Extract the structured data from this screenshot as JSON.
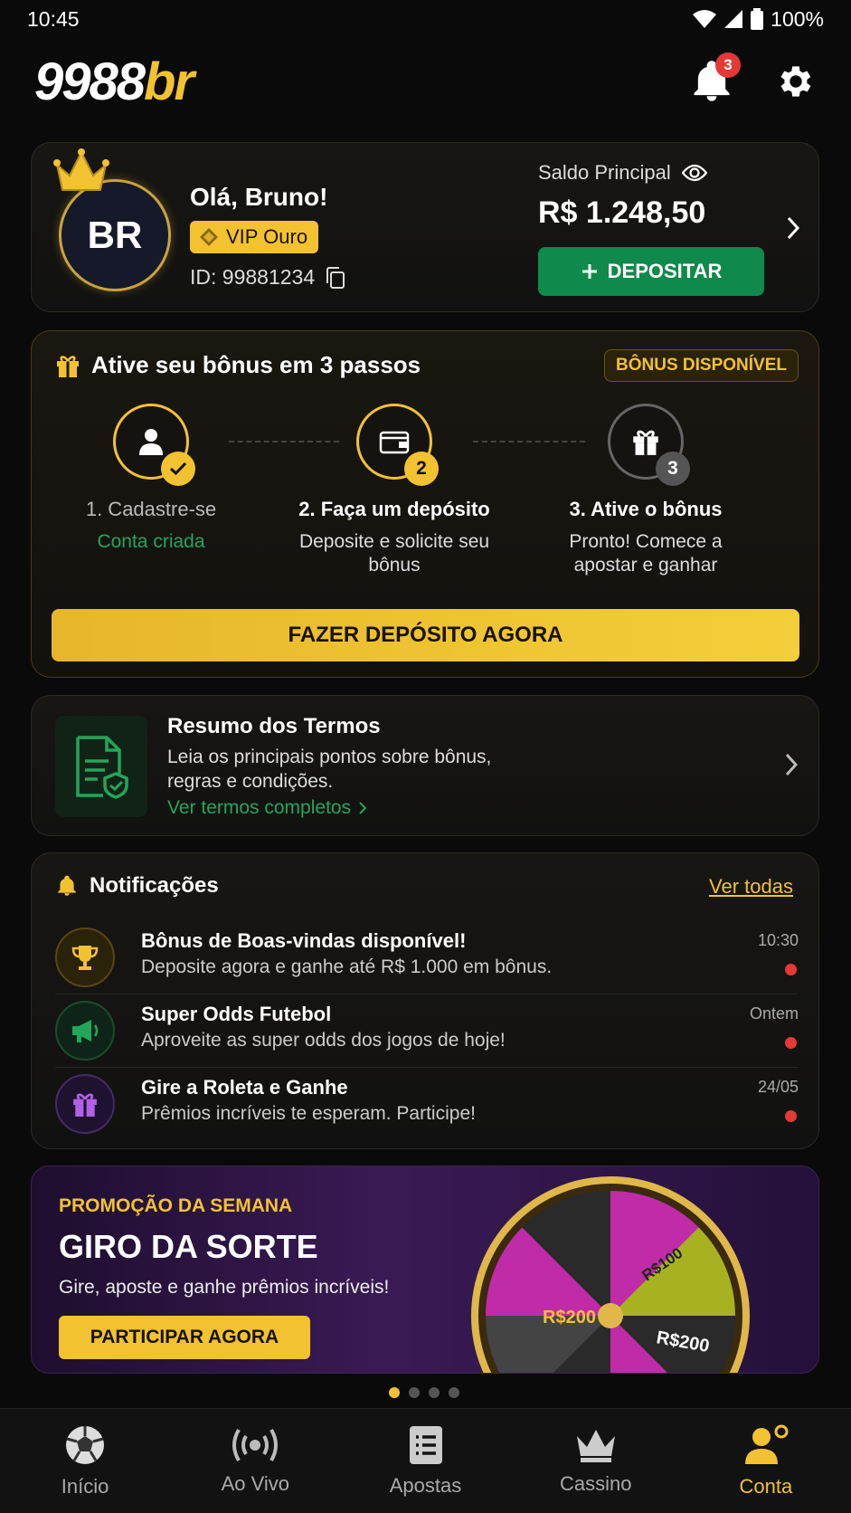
{
  "status": {
    "time": "10:45",
    "battery": "100%"
  },
  "header": {
    "logo_main": "9988",
    "logo_accent": "br",
    "notif_count": "3"
  },
  "profile": {
    "initials": "BR",
    "greeting": "Olá, Bruno!",
    "vip": "VIP Ouro",
    "id": "ID: 99881234",
    "balance_label": "Saldo Principal",
    "balance": "R$ 1.248,50",
    "deposit_label": "DEPOSITAR"
  },
  "bonus": {
    "title": "Ative seu bônus em 3 passos",
    "badge": "BÔNUS DISPONÍVEL",
    "steps": [
      {
        "title": "1. Cadastre-se",
        "sub": "Conta criada",
        "mark": ""
      },
      {
        "title": "2. Faça um depósito",
        "sub": "Deposite e solicite seu bônus",
        "mark": "2"
      },
      {
        "title": "3. Ative o bônus",
        "sub": "Pronto! Comece a apostar e ganhar",
        "mark": "3"
      }
    ],
    "cta": "FAZER DEPÓSITO AGORA"
  },
  "terms": {
    "title": "Resumo dos Termos",
    "desc_line1": "Leia os principais pontos sobre bônus,",
    "desc_line2": "regras e condições.",
    "link": "Ver termos completos"
  },
  "notifications": {
    "title": "Notificações",
    "view_all": "Ver todas",
    "items": [
      {
        "title": "Bônus de Boas-vindas disponível!",
        "desc": "Deposite agora e ganhe até R$ 1.000 em bônus.",
        "time": "10:30"
      },
      {
        "title": "Super Odds Futebol",
        "desc": "Aproveite as super odds dos jogos de hoje!",
        "time": "Ontem"
      },
      {
        "title": "Gire a Roleta e Ganhe",
        "desc": "Prêmios incríveis te esperam. Participe!",
        "time": "24/05"
      }
    ]
  },
  "promo": {
    "kicker": "PROMOÇÃO DA SEMANA",
    "title": "GIRO DA SORTE",
    "sub": "Gire, aposte e ganhe prêmios incríveis!",
    "button": "PARTICIPAR AGORA",
    "wheel_labels": [
      "R$200",
      "R$200",
      "R$100"
    ]
  },
  "nav": {
    "items": [
      {
        "label": "Início"
      },
      {
        "label": "Ao Vivo"
      },
      {
        "label": "Apostas"
      },
      {
        "label": "Cassino"
      },
      {
        "label": "Conta"
      }
    ]
  },
  "colors": {
    "accent": "#f2c230",
    "green": "#0f8a4c",
    "red": "#e53935",
    "background": "#0a0a0a"
  }
}
